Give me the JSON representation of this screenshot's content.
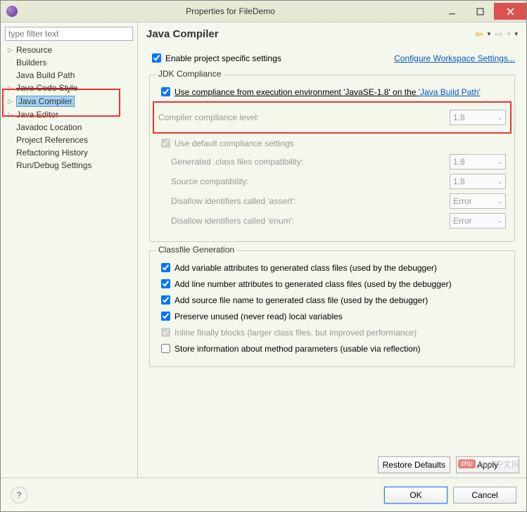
{
  "window": {
    "title": "Properties for FileDemo"
  },
  "sidebar": {
    "filter_placeholder": "type filter text",
    "items": [
      {
        "label": "Resource",
        "expandable": true
      },
      {
        "label": "Builders"
      },
      {
        "label": "Java Build Path"
      },
      {
        "label": "Java Code Style",
        "expandable": true,
        "strike": true
      },
      {
        "label": "Java Compiler",
        "expandable": true,
        "selected": true
      },
      {
        "label": "Java Editor",
        "expandable": true
      },
      {
        "label": "Javadoc Location"
      },
      {
        "label": "Project References"
      },
      {
        "label": "Refactoring History"
      },
      {
        "label": "Run/Debug Settings"
      }
    ]
  },
  "header": {
    "title": "Java Compiler"
  },
  "settings": {
    "enable_project_specific": "Enable project specific settings",
    "configure_workspace": "Configure Workspace Settings...",
    "jdk_group": "JDK Compliance",
    "use_compliance_env": "Use compliance from execution environment 'JavaSE-1.8' on the ",
    "java_build_path_link": "'Java Build Path'",
    "compiler_level_label": "Compiler compliance level:",
    "compiler_level_value": "1.8",
    "use_default": "Use default compliance settings",
    "gen_class_compat_label": "Generated .class files compatibility:",
    "gen_class_compat_value": "1.8",
    "source_compat_label": "Source compatibility:",
    "source_compat_value": "1.8",
    "disallow_assert_label": "Disallow identifiers called 'assert':",
    "disallow_assert_value": "Error",
    "disallow_enum_label": "Disallow identifiers called 'enum':",
    "disallow_enum_value": "Error",
    "classfile_group": "Classfile Generation",
    "cf_var_attr": "Add variable attributes to generated class files (used by the debugger)",
    "cf_line_no": "Add line number attributes to generated class files (used by the debugger)",
    "cf_src_name": "Add source file name to generated class file (used by the debugger)",
    "cf_preserve": "Preserve unused (never read) local variables",
    "cf_inline": "Inline finally blocks (larger class files, but improved performance)",
    "cf_store": "Store information about method parameters (usable via reflection)"
  },
  "buttons": {
    "restore": "Restore Defaults",
    "apply": "Apply",
    "ok": "OK",
    "cancel": "Cancel"
  },
  "watermark": "php 中文网"
}
